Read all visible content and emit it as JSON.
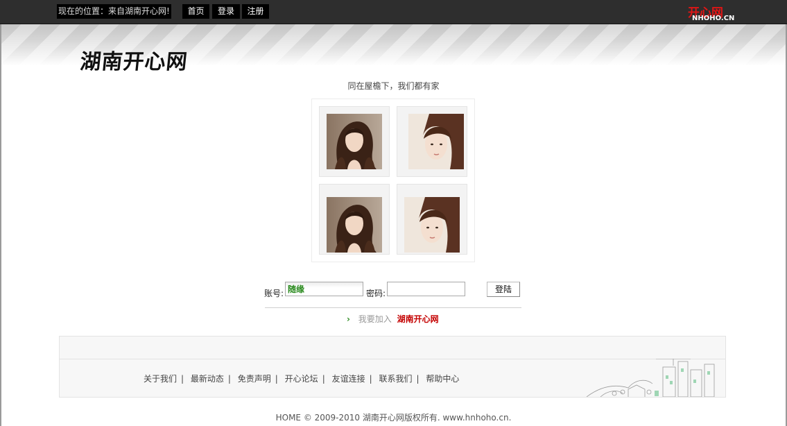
{
  "topbar": {
    "location_text": "现在的位置：来自湖南开心网!",
    "nav": [
      {
        "label": "首页"
      },
      {
        "label": "登录"
      },
      {
        "label": "注册"
      }
    ],
    "logo_top": "开心网",
    "logo_bottom": "NHOHO.CN"
  },
  "header": {
    "brand_title": "湖南开心网",
    "slogan": "同在屋檐下，我们都有家"
  },
  "login": {
    "account_label": "账号:",
    "account_value": "随缘",
    "password_label": "密码:",
    "password_value": "",
    "submit_label": "登陆"
  },
  "join": {
    "arrow": "›",
    "prefix": "我要加入",
    "link": "湖南开心网"
  },
  "footer": {
    "links": [
      "关于我们",
      "最新动态",
      "免责声明",
      "开心论坛",
      "友谊连接",
      "联系我们",
      "帮助中心"
    ],
    "separator": "|",
    "copyright": "HOME © 2009-2010 湖南开心网版权所有. www.hnhoho.cn."
  },
  "colors": {
    "topbar": "#2e2e2e",
    "brand_red": "#c40000",
    "accent_green": "#2a8a1e"
  }
}
